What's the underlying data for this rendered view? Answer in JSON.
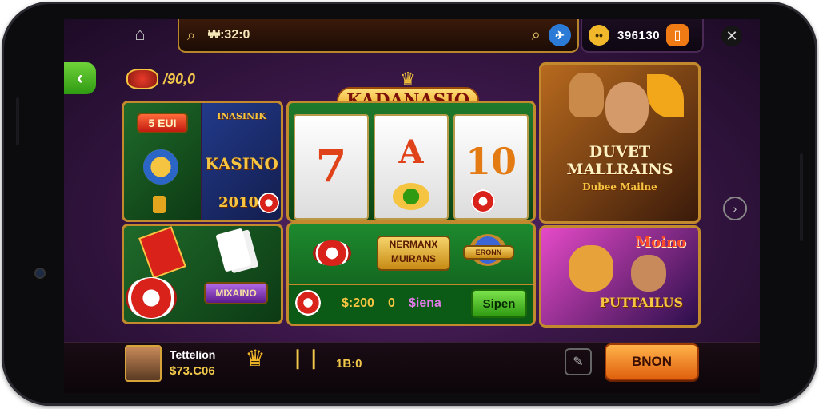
{
  "top_bar": {
    "search_value": "₩:32:0",
    "coins_value": "396130"
  },
  "balance": {
    "value": "/90,0"
  },
  "logo": {
    "text": "KADANASIO"
  },
  "tiles": {
    "tile1_top": "5 EUI",
    "tile1_name_a": "INASINIK",
    "tile1_name_b": "KASINO",
    "tile1_year": "2010",
    "slot_reels": [
      "7",
      "A",
      "10"
    ],
    "slot_banner": "NERMANX MUIRANS",
    "bar_banner": "ERONN",
    "card_banner": "MIXAINO",
    "bet_value": "$:200",
    "bet_count": "0",
    "bet_label": "$iena",
    "spin_label": "Sipen",
    "feature_title": "DUVET MALLRAINS",
    "feature_sub": "Dubee Mailne",
    "promo_title": "Moino",
    "promo_sub": "PUTTAILUS"
  },
  "bottom_bar": {
    "player_name": "Tettelion",
    "player_balance": "$73.C06",
    "bonus_value": "1B:0",
    "play_label": "BNON"
  },
  "colors": {
    "accent_gold": "#c28a2c",
    "play_button": "#e0610e",
    "back_button": "#2f9a12"
  }
}
